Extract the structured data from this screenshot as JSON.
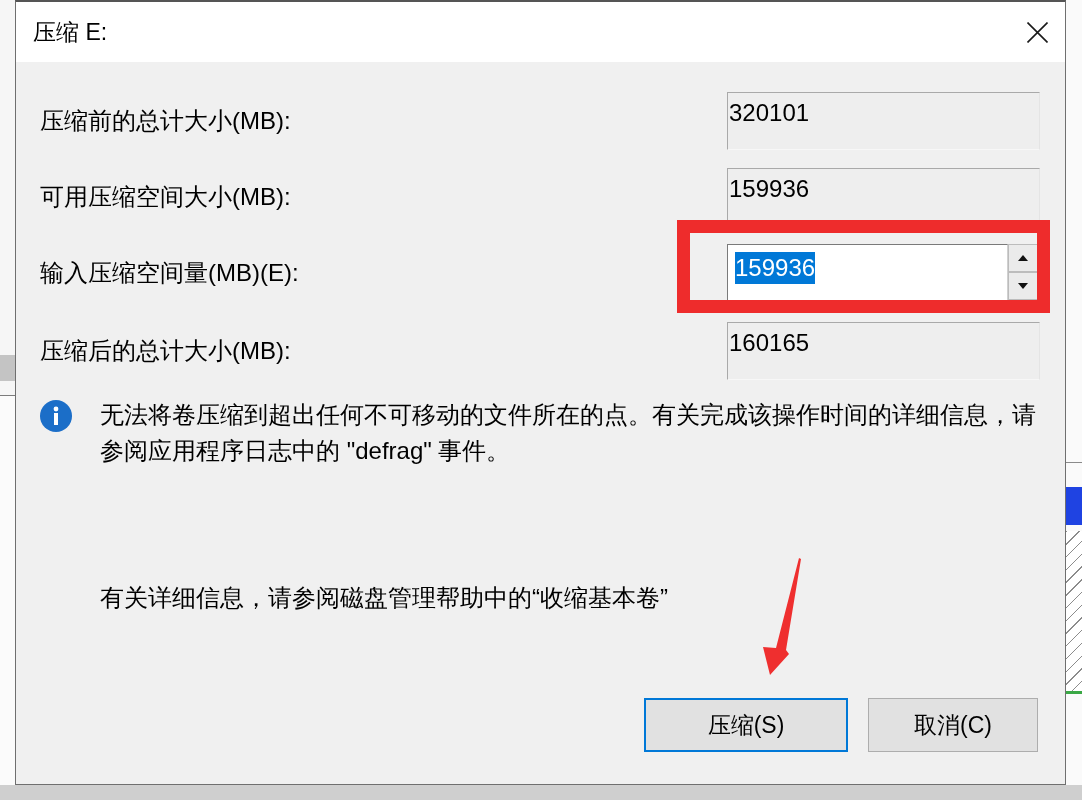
{
  "dialog": {
    "title": "压缩 E:"
  },
  "fields": [
    {
      "kind": "readonly",
      "label": "压缩前的总计大小(MB):",
      "value": "320101",
      "text_selected": false,
      "red_frame": false
    },
    {
      "kind": "readonly",
      "label": "可用压缩空间大小(MB):",
      "value": "159936",
      "text_selected": false,
      "red_frame": false
    },
    {
      "kind": "spin",
      "label": "输入压缩空间量(MB)(E):",
      "value": "159936",
      "text_selected": true,
      "red_frame": true
    },
    {
      "kind": "readonly",
      "label": "压缩后的总计大小(MB):",
      "value": "160165",
      "text_selected": false,
      "red_frame": false
    }
  ],
  "info_message": "无法将卷压缩到超出任何不可移动的文件所在的点。有关完成该操作时间的详细信息，请参阅应用程序日志中的 \"defrag\" 事件。",
  "help_text": "有关详细信息，请参阅磁盘管理帮助中的“收缩基本卷”",
  "buttons": [
    {
      "label": "压缩(S)",
      "default": true,
      "red_arrow": true
    },
    {
      "label": "取消(C)",
      "default": false,
      "red_arrow": false
    }
  ]
}
